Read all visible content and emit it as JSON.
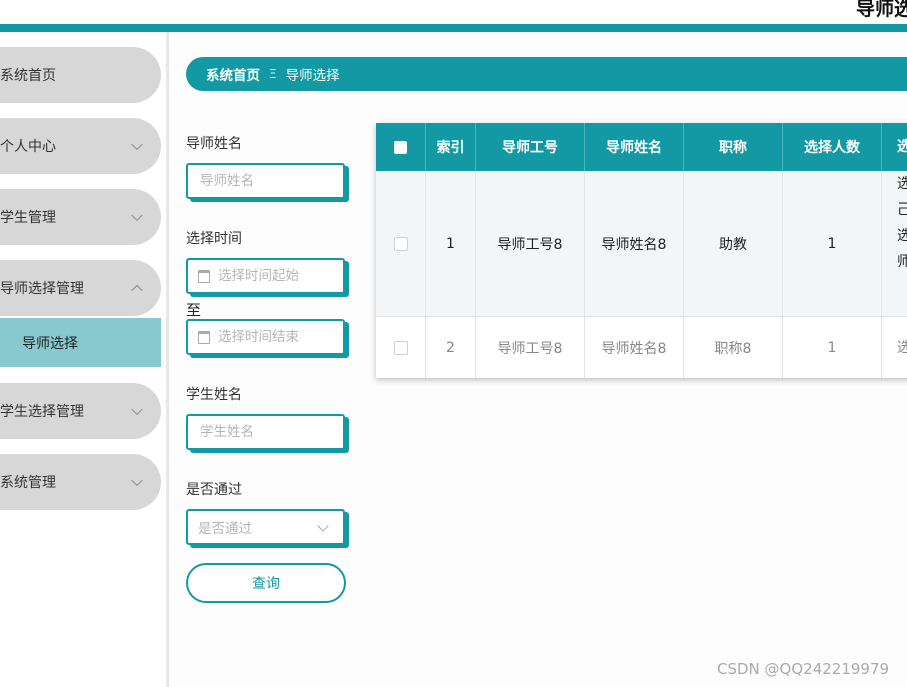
{
  "header": {
    "title": "导师选"
  },
  "sidebar": {
    "items": [
      {
        "label": "系统首页"
      },
      {
        "label": "个人中心"
      },
      {
        "label": "学生管理"
      },
      {
        "label": "导师选择管理"
      },
      {
        "label": "学生选择管理"
      },
      {
        "label": "系统管理"
      }
    ],
    "sub_items": [
      {
        "label": "导师选择"
      }
    ]
  },
  "breadcrumb": {
    "home": "系统首页",
    "separator": "Ξ",
    "current": "导师选择"
  },
  "filters": {
    "teacher_name": {
      "label": "导师姓名",
      "placeholder": "导师姓名"
    },
    "select_time": {
      "label": "选择时间",
      "start_placeholder": "选择时间起始",
      "end_placeholder": "选择时间结束",
      "range_separator": "至"
    },
    "student_name": {
      "label": "学生姓名",
      "placeholder": "学生姓名"
    },
    "passed": {
      "label": "是否通过",
      "placeholder": "是否通过"
    },
    "query_button": "查询"
  },
  "table": {
    "headers": [
      "索引",
      "导师工号",
      "导师姓名",
      "职称",
      "选择人数",
      "选"
    ],
    "rows": [
      {
        "index": "1",
        "teacher_no": "导师工号8",
        "teacher_name": "导师姓名8",
        "title": "助教",
        "count": "1",
        "note": [
          "选",
          "己",
          "选",
          "师"
        ]
      },
      {
        "index": "2",
        "teacher_no": "导师工号8",
        "teacher_name": "导师姓名8",
        "title": "职称8",
        "count": "1",
        "note": [
          "选"
        ]
      }
    ]
  },
  "watermark": "CSDN @QQ242219979",
  "colors": {
    "accent": "#1399a3",
    "submenu_active": "#86c9cf",
    "menu_bg": "#d7d7d7"
  }
}
